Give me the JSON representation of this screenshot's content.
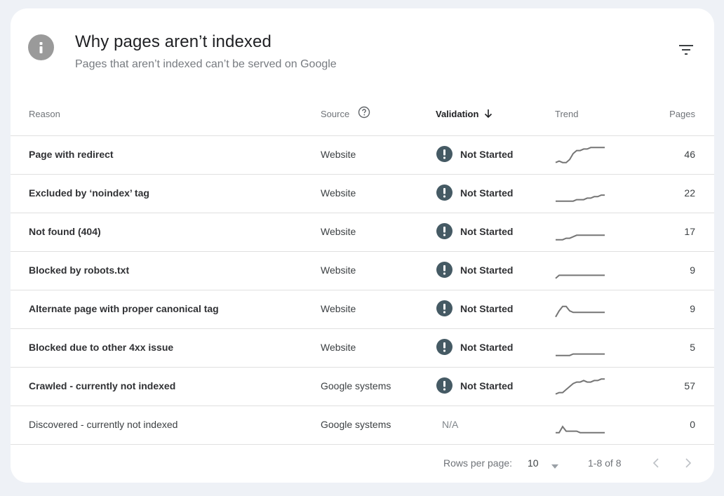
{
  "header": {
    "title": "Why pages aren’t indexed",
    "subtitle": "Pages that aren’t indexed can’t be served on Google",
    "icon": "info-icon",
    "filter_icon": "filter-icon"
  },
  "columns": {
    "reason": "Reason",
    "source": "Source",
    "source_help_icon": "help-circle-icon",
    "validation": "Validation",
    "validation_sort_icon": "arrow-down-icon",
    "trend": "Trend",
    "pages": "Pages"
  },
  "rows": [
    {
      "reason": "Page with redirect",
      "source": "Website",
      "validation": "Not Started",
      "validation_icon": "exclamation-circle-icon",
      "pages": "46",
      "trend": [
        10,
        11,
        10,
        10,
        12,
        16,
        18,
        18,
        19,
        19,
        20,
        20,
        20,
        20,
        20
      ],
      "muted": false
    },
    {
      "reason": "Excluded by ‘noindex’ tag",
      "source": "Website",
      "validation": "Not Started",
      "validation_icon": "exclamation-circle-icon",
      "pages": "22",
      "trend": [
        10,
        10,
        10,
        10,
        10,
        10,
        11,
        11,
        11,
        12,
        12,
        13,
        13,
        14,
        14
      ],
      "muted": false
    },
    {
      "reason": "Not found (404)",
      "source": "Website",
      "validation": "Not Started",
      "validation_icon": "exclamation-circle-icon",
      "pages": "17",
      "trend": [
        10,
        10,
        10,
        11,
        11,
        12,
        13,
        13,
        13,
        13,
        13,
        13,
        13,
        13,
        13
      ],
      "muted": false
    },
    {
      "reason": "Blocked by robots.txt",
      "source": "Website",
      "validation": "Not Started",
      "validation_icon": "exclamation-circle-icon",
      "pages": "9",
      "trend": [
        10,
        12,
        12,
        12,
        12,
        12,
        12,
        12,
        12,
        12,
        12,
        12,
        12,
        12,
        12
      ],
      "muted": false
    },
    {
      "reason": "Alternate page with proper canonical tag",
      "source": "Website",
      "validation": "Not Started",
      "validation_icon": "exclamation-circle-icon",
      "pages": "9",
      "trend": [
        10,
        14,
        17,
        17,
        14,
        13,
        13,
        13,
        13,
        13,
        13,
        13,
        13,
        13,
        13
      ],
      "muted": false
    },
    {
      "reason": "Blocked due to other 4xx issue",
      "source": "Website",
      "validation": "Not Started",
      "validation_icon": "exclamation-circle-icon",
      "pages": "5",
      "trend": [
        10,
        10,
        10,
        10,
        10,
        11,
        11,
        11,
        11,
        11,
        11,
        11,
        11,
        11,
        11
      ],
      "muted": false
    },
    {
      "reason": "Crawled - currently not indexed",
      "source": "Google systems",
      "validation": "Not Started",
      "validation_icon": "exclamation-circle-icon",
      "pages": "57",
      "trend": [
        10,
        11,
        11,
        13,
        15,
        17,
        18,
        18,
        19,
        18,
        18,
        19,
        19,
        20,
        20
      ],
      "muted": false
    },
    {
      "reason": "Discovered - currently not indexed",
      "source": "Google systems",
      "validation": "N/A",
      "validation_icon": "",
      "pages": "0",
      "trend": [
        10,
        10,
        14,
        11,
        11,
        11,
        11,
        10,
        10,
        10,
        10,
        10,
        10,
        10,
        10
      ],
      "muted": true
    }
  ],
  "footer": {
    "rows_per_page_label": "Rows per page:",
    "rows_per_page_value": "10",
    "range": "1-8 of 8",
    "prev_icon": "chevron-left-icon",
    "next_icon": "chevron-right-icon"
  },
  "colors": {
    "validation_icon_bg": "#455a64",
    "info_icon_bg": "#9a9a9a",
    "trend_line": "#757575"
  }
}
